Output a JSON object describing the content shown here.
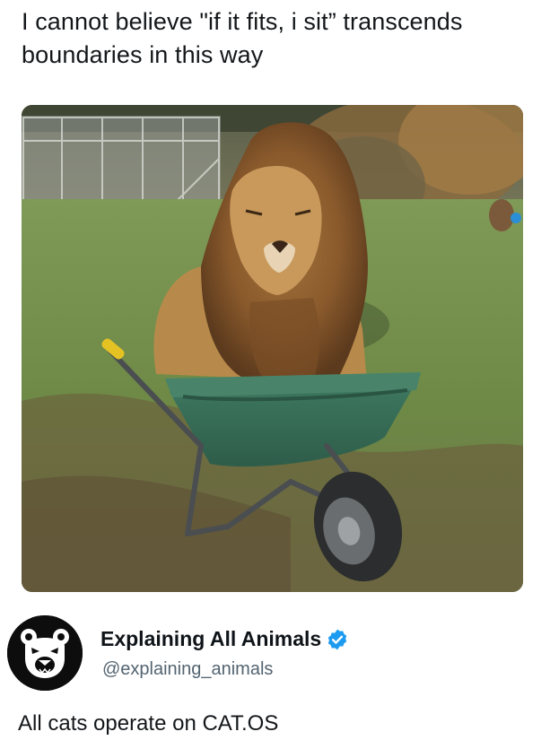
{
  "caption": {
    "text": "I cannot believe \"if it fits, i sit” transcends boundaries in this way"
  },
  "photo": {
    "subject": "lion-in-wheelbarrow"
  },
  "author": {
    "display_name": "Explaining All Animals",
    "handle": "@explaining_animals",
    "verified": true,
    "verified_color": "#1d9bf0",
    "avatar_icon": "bear-head-icon"
  },
  "post": {
    "text": "All cats operate on CAT.OS"
  }
}
